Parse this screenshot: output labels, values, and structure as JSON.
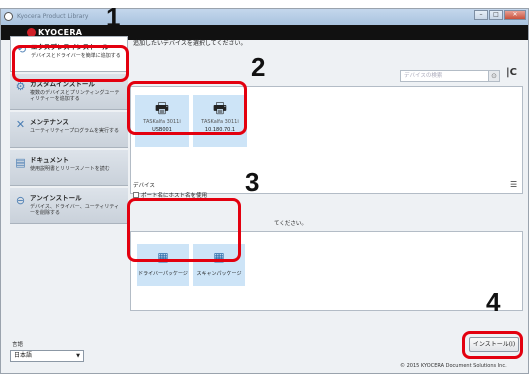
{
  "window": {
    "title": "Kyocera Product Library",
    "buttons": {
      "minimize": "–",
      "maximize": "□",
      "close": "✕"
    }
  },
  "brand": {
    "name": "KYOCERA"
  },
  "sidebar": {
    "items": [
      {
        "title": "エクスプレスインストール",
        "desc": "デバイスとドライバーを簡単に追加する",
        "icon": "install-icon",
        "glyph": "⟲"
      },
      {
        "title": "カスタムインストール",
        "desc": "複数のデバイスとプリンティングユーティリティーを追加する",
        "icon": "custom-install-icon",
        "glyph": "⚙"
      },
      {
        "title": "メンテナンス",
        "desc": "ユーティリティープログラムを実行する",
        "icon": "maintenance-icon",
        "glyph": "✕"
      },
      {
        "title": "ドキュメント",
        "desc": "使用説明書とリリースノートを読む",
        "icon": "document-icon",
        "glyph": "▤"
      },
      {
        "title": "アンインストール",
        "desc": "デバイス、ドライバー、ユーティリティーを削除する",
        "icon": "uninstall-icon",
        "glyph": "⊖"
      }
    ],
    "language_label": "言語",
    "language_value": "日本語"
  },
  "main": {
    "instruction_device": "追加したいデバイスを選択してください。",
    "search_placeholder": "デバイスの検索",
    "devices": [
      {
        "name": "TASKalfa 3011i",
        "port": "USB001"
      },
      {
        "name": "TASKalfa 3011i",
        "port": "10.180.70.1"
      }
    ],
    "option_label": "デバイス",
    "option_checkbox": "ポート名にホスト名を使用",
    "instruction_package": "てください。",
    "packages": [
      {
        "label": "ドライバーパッケージ"
      },
      {
        "label": "スキャンパッケージ"
      }
    ],
    "install_button": "インストール(I)"
  },
  "footer": {
    "copyright": "© 2015 KYOCERA Document Solutions Inc."
  },
  "callouts": {
    "one": "1",
    "two": "2",
    "three": "3",
    "four": "4"
  },
  "colors": {
    "callout": "#e3000f",
    "selection": "#cde4f7",
    "brand_bar": "#111111"
  }
}
